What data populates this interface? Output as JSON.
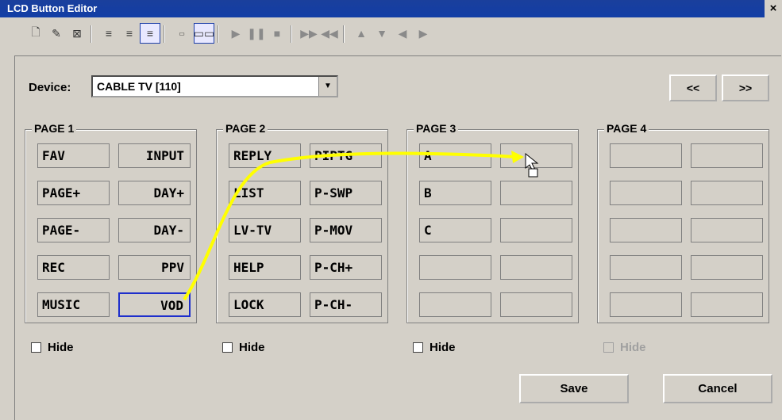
{
  "window": {
    "title": "LCD Button Editor",
    "close": "×"
  },
  "toolbar": {
    "icons": [
      "new-doc-icon",
      "edit-doc-icon",
      "delete-doc-icon",
      "align-left-icon",
      "align-center-icon",
      "align-right-icon",
      "text-mode-icon",
      "button-mode-icon",
      "play-icon",
      "pause-icon",
      "stop-icon",
      "fast-forward-icon",
      "rewind-icon",
      "up-icon",
      "down-icon",
      "left-icon",
      "right-icon"
    ]
  },
  "device": {
    "label": "Device:",
    "value": "CABLE TV [110]"
  },
  "nav": {
    "prev": "<<",
    "next": ">>"
  },
  "pages": [
    {
      "title": "PAGE 1",
      "buttons": [
        [
          "FAV",
          "INPUT"
        ],
        [
          "PAGE+",
          "DAY+"
        ],
        [
          "PAGE-",
          "DAY-"
        ],
        [
          "REC",
          "PPV"
        ],
        [
          "MUSIC",
          "VOD"
        ]
      ]
    },
    {
      "title": "PAGE 2",
      "buttons": [
        [
          "REPLY",
          "PIPTG"
        ],
        [
          "LIST",
          "P-SWP"
        ],
        [
          "LV-TV",
          "P-MOV"
        ],
        [
          "HELP",
          "P-CH+"
        ],
        [
          "LOCK",
          "P-CH-"
        ]
      ]
    },
    {
      "title": "PAGE 3",
      "buttons": [
        [
          "A",
          ""
        ],
        [
          "B",
          ""
        ],
        [
          "C",
          ""
        ],
        [
          "",
          ""
        ],
        [
          "",
          ""
        ]
      ]
    },
    {
      "title": "PAGE 4",
      "buttons": [
        [
          "",
          ""
        ],
        [
          "",
          ""
        ],
        [
          "",
          ""
        ],
        [
          "",
          ""
        ],
        [
          "",
          ""
        ]
      ]
    }
  ],
  "hide": {
    "label": "Hide"
  },
  "actions": {
    "save": "Save",
    "cancel": "Cancel"
  },
  "colors": {
    "selection": "#1e2fcc",
    "arrow": "#ffff00"
  }
}
